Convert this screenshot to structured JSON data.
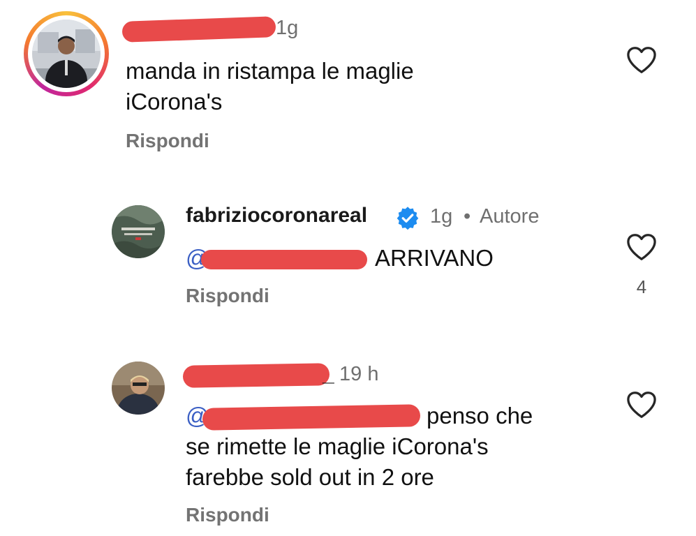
{
  "comments": [
    {
      "username": "",
      "time": "1g",
      "text": "manda in ristampa le maglie iCorona's",
      "reply_label": "Rispondi",
      "likes": ""
    },
    {
      "username": "fabriziocoronareal",
      "time": "1g",
      "separator": "•",
      "author_badge": "Autore",
      "mention_prefix": "@",
      "text": "ARRIVANO",
      "reply_label": "Rispondi",
      "likes": "4"
    },
    {
      "username": "",
      "username_suffix": "_",
      "time": "19 h",
      "mention_prefix": "@",
      "text_line1": "penso che",
      "text_line2": "se rimette le maglie iCorona's",
      "text_line3": "farebbe sold out in 2 ore",
      "reply_label": "Rispondi",
      "likes": ""
    }
  ],
  "icons": {
    "heart": "heart-icon",
    "verified": "verified-badge-icon"
  },
  "colors": {
    "redaction": "#e84a4a",
    "mention": "#3b5fc4",
    "verified": "#1d8cf0",
    "secondary_text": "#737373"
  }
}
